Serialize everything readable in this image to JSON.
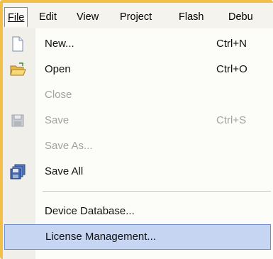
{
  "menubar": {
    "items": [
      {
        "label": "File",
        "active": true
      },
      {
        "label": "Edit"
      },
      {
        "label": "View"
      },
      {
        "label": "Project"
      },
      {
        "label": "Flash"
      },
      {
        "label": "Debu"
      }
    ]
  },
  "file_menu": {
    "items": [
      {
        "label": "New...",
        "shortcut": "Ctrl+N",
        "icon": "new-document-icon",
        "enabled": true
      },
      {
        "label": "Open",
        "shortcut": "Ctrl+O",
        "icon": "open-folder-icon",
        "enabled": true
      },
      {
        "label": "Close",
        "enabled": false
      },
      {
        "label": "Save",
        "shortcut": "Ctrl+S",
        "icon": "save-disk-icon",
        "enabled": false
      },
      {
        "label": "Save As...",
        "enabled": false
      },
      {
        "label": "Save All",
        "icon": "save-all-icon",
        "enabled": true
      },
      {
        "label": "Device Database...",
        "enabled": true
      },
      {
        "label": "License Management...",
        "enabled": true,
        "selected": true
      }
    ]
  },
  "colors": {
    "highlight": "#c6d5f1",
    "highlight_border": "#6f8fd0",
    "frame_border": "#f2c04a",
    "disabled_text": "#a3a39e"
  }
}
